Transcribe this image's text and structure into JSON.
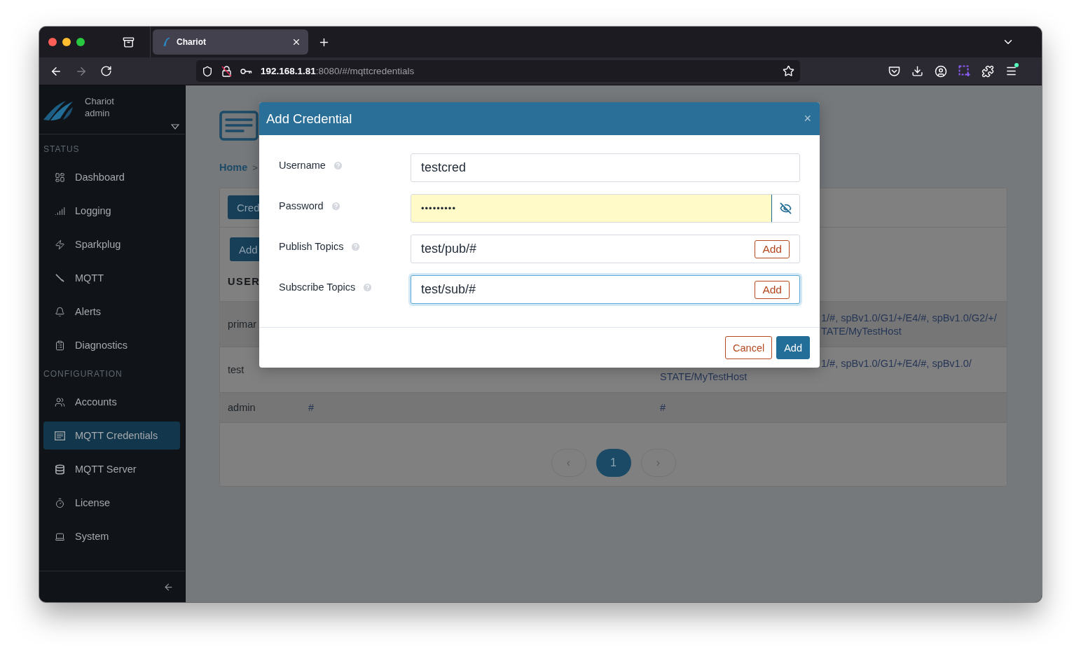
{
  "browser": {
    "tabs": [
      {
        "title": "Chariot",
        "selected": true
      }
    ],
    "forward_disabled": true,
    "url_host": "192.168.1.81",
    "url_rest": ":8080/#/mqttcredentials"
  },
  "sidebar": {
    "app_name": "Chariot",
    "user": "admin",
    "sections": [
      {
        "title": "STATUS",
        "items": [
          {
            "label": "Dashboard",
            "selected": false
          },
          {
            "label": "Logging",
            "selected": false
          },
          {
            "label": "Sparkplug",
            "selected": false
          },
          {
            "label": "MQTT",
            "selected": false
          },
          {
            "label": "Alerts",
            "selected": false
          },
          {
            "label": "Diagnostics",
            "selected": false
          }
        ]
      },
      {
        "title": "CONFIGURATION",
        "items": [
          {
            "label": "Accounts",
            "selected": false
          },
          {
            "label": "MQTT Credentials",
            "selected": true
          },
          {
            "label": "MQTT Server",
            "selected": false
          },
          {
            "label": "License",
            "selected": false
          },
          {
            "label": "System",
            "selected": false
          }
        ]
      }
    ]
  },
  "page": {
    "breadcrumb": {
      "home": "Home",
      "separator": ">"
    },
    "card": {
      "tab_button": "Cred",
      "add_button": "Add",
      "column_1_heading": "USER",
      "rows": [
        {
          "column_1": "primar",
          "column_3_lines": [
            {
              "text": "1/#, spBv1.0/G1/+/E4/#, spBv1.0/G2/+/",
              "kind": "beside_dialog"
            },
            {
              "text": "TATE/MyTestHost",
              "kind": "beside_dialog"
            }
          ]
        },
        {
          "column_1": "test",
          "column_3_lines": [
            {
              "text": "1/#, spBv1.0/G1/+/E4/#, spBv1.0/",
              "kind": "beside_dialog"
            },
            {
              "text": "STATE/MyTestHost",
              "kind": "full"
            }
          ]
        },
        {
          "column_1": "admin",
          "column_2": "#",
          "column_3_lines": [
            {
              "text": "#",
              "kind": "full"
            }
          ]
        }
      ],
      "pagination": [
        {
          "label": "‹",
          "selected": false
        },
        {
          "label": "1",
          "selected": true
        },
        {
          "label": "›",
          "selected": false
        }
      ]
    }
  },
  "dialog": {
    "title": "Add Credential",
    "close": "×",
    "fields": [
      {
        "label": "Username",
        "kind": "text",
        "value": "testcred",
        "focused": false,
        "autofilled": false
      },
      {
        "label": "Password",
        "kind": "password",
        "value": "•••••••••",
        "focused": false,
        "autofilled": true
      },
      {
        "label": "Publish Topics",
        "kind": "topic",
        "value": "test/pub/#",
        "add_button": "Add",
        "focused": false,
        "autofilled": false
      },
      {
        "label": "Subscribe Topics",
        "kind": "topic",
        "value": "test/sub/#",
        "add_button": "Add",
        "focused": true,
        "autofilled": false
      }
    ],
    "buttons": [
      {
        "label": "Cancel",
        "kind": "secondary"
      },
      {
        "label": "Add",
        "kind": "primary"
      }
    ]
  }
}
